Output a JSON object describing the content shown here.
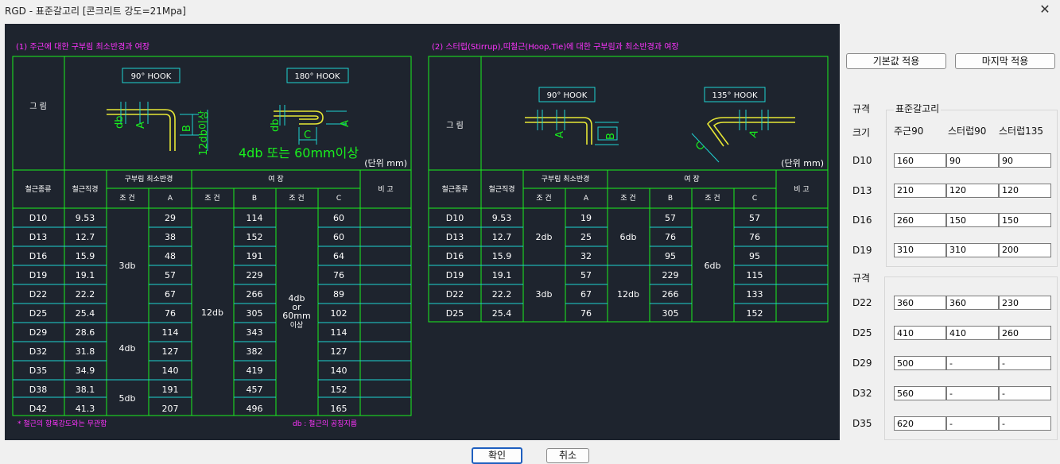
{
  "window": {
    "title": "RGD - 표준갈고리  [콘크리트 강도=21Mpa]",
    "close": "✕"
  },
  "drawing": {
    "colors": {
      "background": "#1e242e",
      "grid": "#19f01e",
      "cyan": "#1fd3d3",
      "magenta": "#ff33ff",
      "white": "#ffffff",
      "yellow": "#e6e635",
      "green": "#19f01e"
    },
    "section1": {
      "title": "(1) 주근에 대한 구부림 최소반경과 여장",
      "figure_label": "그 림",
      "hook1_label": "90° HOOK",
      "hook2_label": "180° HOOK",
      "dim_db": "db",
      "dim_a": "A",
      "dim_b": "B",
      "dim_c": "C",
      "dim_12db": "12db이상",
      "note_4db": "4db 또는 60mm이상",
      "unit": "(단위 mm)",
      "h_type": "철근종류",
      "h_dia": "철근직경",
      "h_bend": "구부림 최소반경",
      "h_ext": "여 장",
      "h_note": "비 고",
      "h_cond": "조 건",
      "h_a": "A",
      "h_b": "B",
      "h_c": "C",
      "rows": [
        [
          "D10",
          "9.53",
          "29",
          "114",
          "60"
        ],
        [
          "D13",
          "12.7",
          "38",
          "152",
          "60"
        ],
        [
          "D16",
          "15.9",
          "48",
          "191",
          "64"
        ],
        [
          "D19",
          "19.1",
          "57",
          "229",
          "76"
        ],
        [
          "D22",
          "22.2",
          "67",
          "266",
          "89"
        ],
        [
          "D25",
          "25.4",
          "76",
          "305",
          "102"
        ],
        [
          "D29",
          "28.6",
          "114",
          "343",
          "114"
        ],
        [
          "D32",
          "31.8",
          "127",
          "382",
          "127"
        ],
        [
          "D35",
          "34.9",
          "140",
          "419",
          "140"
        ],
        [
          "D38",
          "38.1",
          "191",
          "457",
          "152"
        ],
        [
          "D42",
          "41.3",
          "207",
          "496",
          "165"
        ]
      ],
      "cond_3db": "3db",
      "cond_4db": "4db",
      "cond_5db": "5db",
      "cond_12db": "12db",
      "cond_c1": "4db",
      "cond_c2": "or",
      "cond_c3": "60mm",
      "cond_c4": "이상",
      "footnote1": "* 철근의 항복강도와는 무관함",
      "footnote2": "db : 철근의 공칭지름"
    },
    "section2": {
      "title": "(2) 스터럽(Stirrup),띠철근(Hoop,Tie)에 대한 구부림과 최소반경과 여장",
      "figure_label": "그 림",
      "hook1_label": "90° HOOK",
      "hook2_label": "135° HOOK",
      "dim_a": "A",
      "dim_b": "B",
      "dim_c": "C",
      "unit": "(단위 mm)",
      "h_type": "철근종류",
      "h_dia": "철근직경",
      "h_bend": "구부림 최소반경",
      "h_ext": "여 장",
      "h_note": "비 고",
      "h_cond": "조 건",
      "h_a": "A",
      "h_b": "B",
      "h_c": "C",
      "rows": [
        [
          "D10",
          "9.53",
          "19",
          "57",
          "57"
        ],
        [
          "D13",
          "12.7",
          "25",
          "76",
          "76"
        ],
        [
          "D16",
          "15.9",
          "32",
          "95",
          "95"
        ],
        [
          "D19",
          "19.1",
          "57",
          "229",
          "115"
        ],
        [
          "D22",
          "22.2",
          "67",
          "266",
          "133"
        ],
        [
          "D25",
          "25.4",
          "76",
          "305",
          "152"
        ]
      ],
      "cond_2db": "2db",
      "cond_3db": "3db",
      "cond_6db": "6db",
      "cond_12db": "12db",
      "cond_c": "6db"
    }
  },
  "side": {
    "default_btn": "기본값 적용",
    "last_btn": "마지막 적용",
    "group1_title": "규격",
    "group2_title": "표준갈고리",
    "group3_title": "규격",
    "size_label": "크기",
    "col1": "주근90",
    "col2": "스터럽90",
    "col3": "스터럽135",
    "rows1": [
      {
        "label": "D10",
        "v1": "160",
        "v2": "90",
        "v3": "90"
      },
      {
        "label": "D13",
        "v1": "210",
        "v2": "120",
        "v3": "120"
      },
      {
        "label": "D16",
        "v1": "260",
        "v2": "150",
        "v3": "150"
      },
      {
        "label": "D19",
        "v1": "310",
        "v2": "310",
        "v3": "200"
      }
    ],
    "rows2": [
      {
        "label": "D22",
        "v1": "360",
        "v2": "360",
        "v3": "230"
      },
      {
        "label": "D25",
        "v1": "410",
        "v2": "410",
        "v3": "260"
      },
      {
        "label": "D29",
        "v1": "500",
        "v2": "-",
        "v3": "-"
      },
      {
        "label": "D32",
        "v1": "560",
        "v2": "-",
        "v3": "-"
      },
      {
        "label": "D35",
        "v1": "620",
        "v2": "-",
        "v3": "-"
      }
    ]
  },
  "footer": {
    "ok": "확인",
    "cancel": "취소"
  }
}
